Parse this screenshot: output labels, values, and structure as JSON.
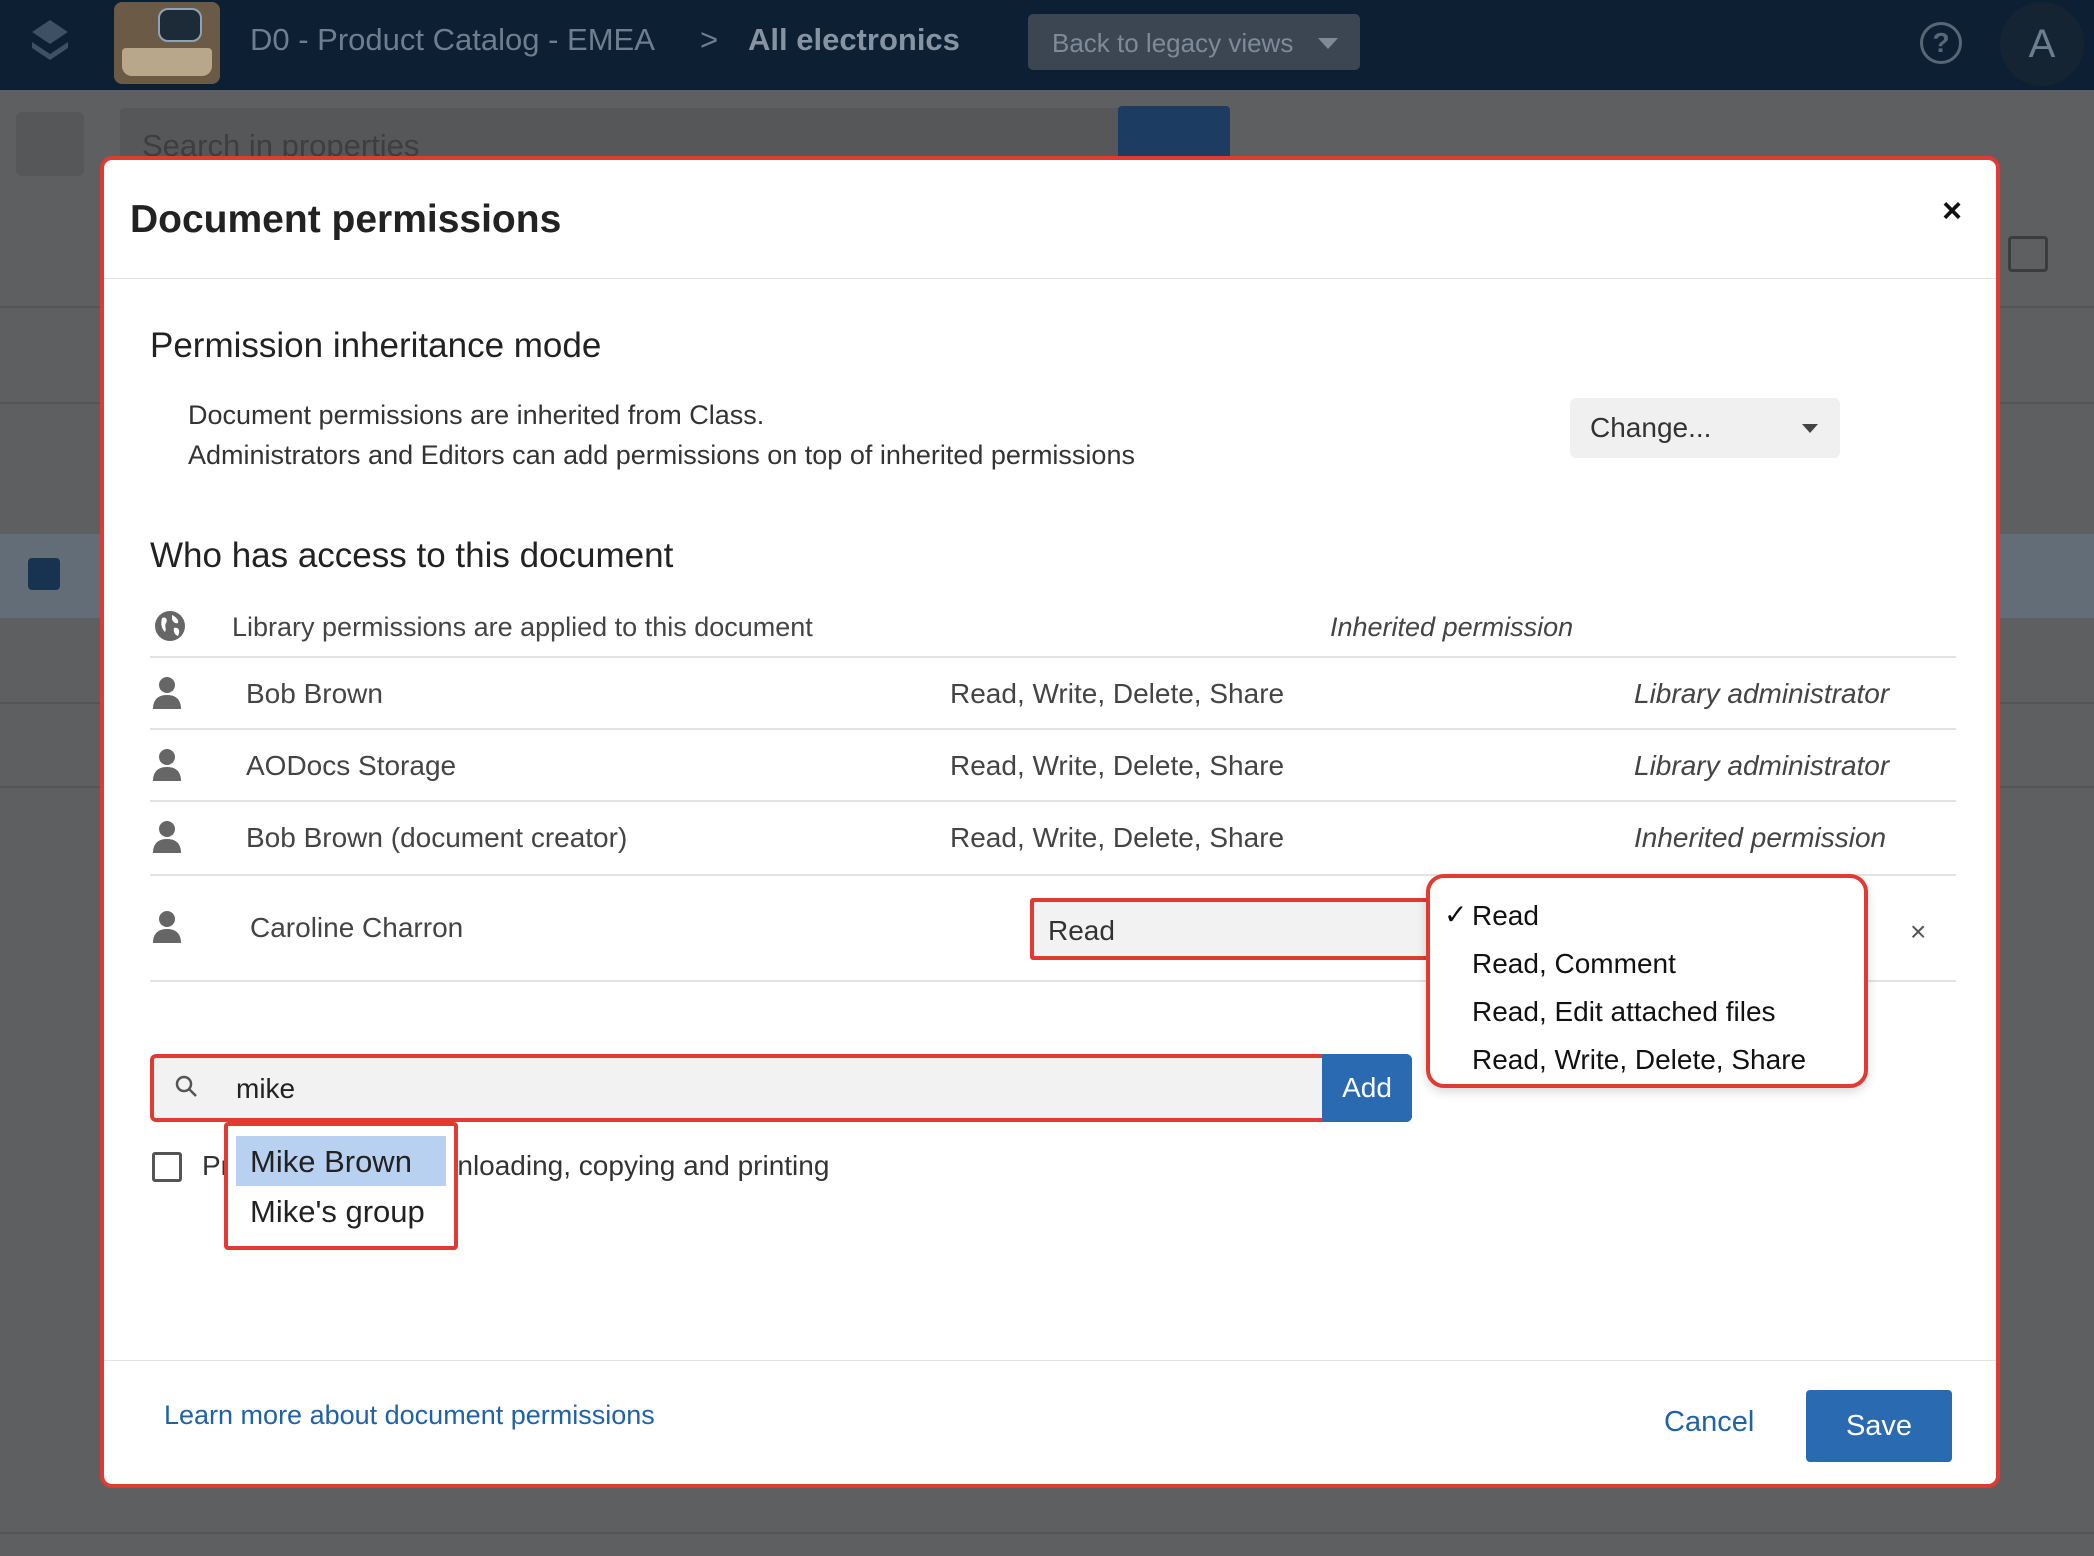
{
  "app": {
    "breadcrumb_library": "D0 - Product Catalog - EMEA",
    "breadcrumb_sep": ">",
    "breadcrumb_view": "All electronics",
    "legacy_button": "Back to legacy views",
    "avatar_initial": "A",
    "help_glyph": "?",
    "search_placeholder": "Search in properties"
  },
  "dialog": {
    "title": "Document permissions",
    "close_glyph": "×",
    "inheritance": {
      "heading": "Permission inheritance mode",
      "line1": "Document permissions are inherited from Class.",
      "line2": "Administrators and Editors can add permissions on top of inherited permissions",
      "change_button": "Change..."
    },
    "access": {
      "heading": "Who has access to this document",
      "library_text": "Library permissions are applied to this document",
      "library_role": "Inherited permission",
      "rows": [
        {
          "name": "Bob Brown",
          "perms": "Read, Write, Delete, Share",
          "role": "Library administrator"
        },
        {
          "name": "AODocs Storage",
          "perms": "Read, Write, Delete, Share",
          "role": "Library administrator"
        },
        {
          "name": "Bob Brown (document creator)",
          "perms": "Read, Write, Delete, Share",
          "role": "Inherited permission"
        }
      ],
      "editable_row": {
        "name": "Caroline Charron",
        "selected_permission": "Read"
      },
      "permission_options": [
        {
          "label": "Read",
          "checked": true
        },
        {
          "label": "Read, Comment",
          "checked": false
        },
        {
          "label": "Read, Edit attached files",
          "checked": false
        },
        {
          "label": "Read, Write, Delete, Share",
          "checked": false
        }
      ],
      "check_glyph": "✓"
    },
    "add": {
      "input_value": "mike",
      "button": "Add",
      "suggestions": [
        {
          "label": "Mike Brown",
          "active": true
        },
        {
          "label": "Mike's group",
          "active": false
        }
      ]
    },
    "prevent": {
      "label_prefix": "Pr",
      "label_suffix": "downloading, copying and printing"
    },
    "footer": {
      "learn_more": "Learn more about document permissions",
      "cancel": "Cancel",
      "save": "Save"
    }
  },
  "colors": {
    "accent_blue": "#2a6ab0",
    "highlight_red": "#e03a32",
    "suggestion_active": "#b9d1f0"
  },
  "icons": [
    "logo-icon",
    "help-icon",
    "globe-icon",
    "person-icon",
    "search-icon",
    "chevron-down-icon",
    "close-icon"
  ]
}
